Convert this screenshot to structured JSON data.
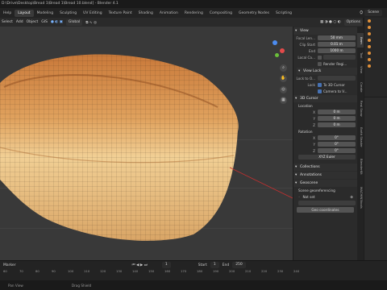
{
  "window": {
    "title": "D:\\Drive\\Desktop\\Bread 1\\Bread 1\\Bread 10.blend] - Blender 4.1"
  },
  "menubar": {
    "help": "Help",
    "tabs": [
      "Layout",
      "Modeling",
      "Sculpting",
      "UV Editing",
      "Texture Paint",
      "Shading",
      "Animation",
      "Rendering",
      "Compositing",
      "Geometry Nodes",
      "Scripting"
    ],
    "scene_label": "Scene"
  },
  "header3d": {
    "items": [
      "Select",
      "Add",
      "Object",
      "GIS"
    ],
    "orientation": "Global",
    "options": "Options"
  },
  "npanel": {
    "view": {
      "title": "View",
      "focal_label": "Focal Len...",
      "focal_value": "50 mm",
      "clip_start_label": "Clip Start",
      "clip_start_value": "0.01 m",
      "clip_end_label": "End",
      "clip_end_value": "1000 m",
      "local_camera_label": "Local Ca...",
      "render_region_label": "Render Regi..."
    },
    "view_lock": {
      "title": "View Lock",
      "lock_to_label": "Lock to O...",
      "lock_label": "Lock",
      "to_3d_cursor": "To 3D Cursor",
      "camera_to_view": "Camera to V..."
    },
    "cursor": {
      "title": "3D Cursor",
      "location_label": "Location",
      "x_label": "X",
      "x_value": "0 m",
      "y_label": "Y",
      "y_value": "0 m",
      "z_label": "Z",
      "z_value": "0 m",
      "rotation_label": "Rotation",
      "rx_value": "0°",
      "ry_value": "0°",
      "rz_value": "0°",
      "mode": "XYZ Euler"
    },
    "collections": "Collections",
    "annotations": "Annotations",
    "geo": {
      "title": "Geoscene",
      "subtitle": "Scene georeferencing",
      "not_set": "Not set",
      "button": "Geo coordinates"
    }
  },
  "vtabs": [
    "Item",
    "Tool",
    "View",
    "Create",
    "Real Snow",
    "Earth Shader",
    "BlenderKit",
    "MACHIN3tools"
  ],
  "timeline": {
    "marker": "Marker",
    "start_label": "Start",
    "start_value": "1",
    "end_label": "End",
    "end_value": "250",
    "current_frame": "1",
    "ticks": [
      "60",
      "70",
      "80",
      "90",
      "100",
      "110",
      "120",
      "130",
      "140",
      "150",
      "160",
      "170",
      "180",
      "190",
      "200",
      "210",
      "220",
      "230",
      "240"
    ]
  },
  "statusbar": {
    "pan": "Pan View",
    "drop": "Drag Shield"
  }
}
